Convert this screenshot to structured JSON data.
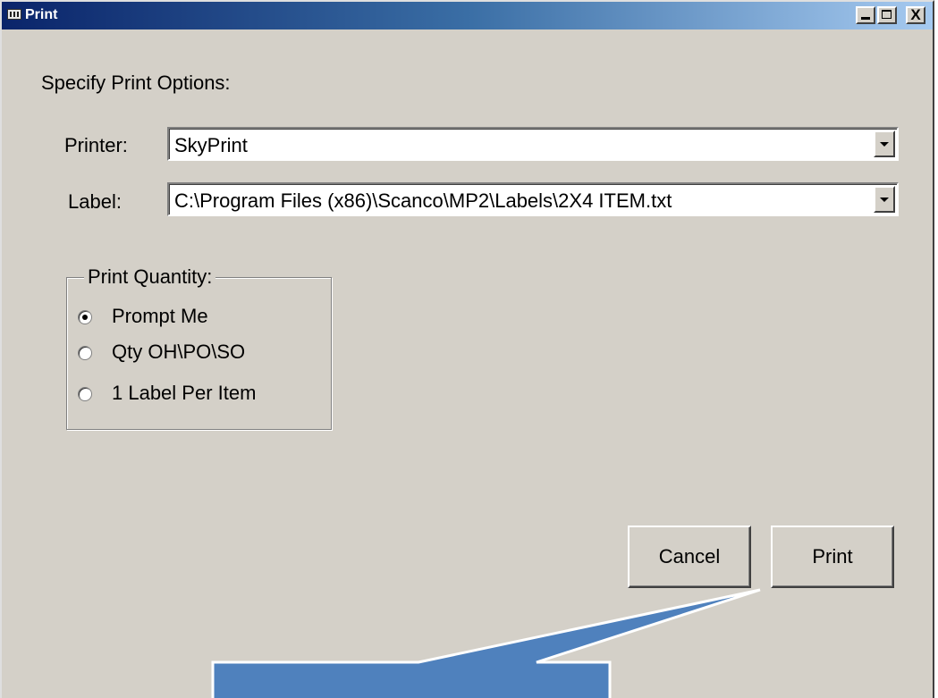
{
  "window": {
    "title": "Print",
    "controls": {
      "minimize": "_",
      "maximize": "□",
      "close": "X"
    }
  },
  "dialog": {
    "heading": "Specify Print Options:",
    "printer": {
      "label": "Printer:",
      "value": "SkyPrint"
    },
    "label_field": {
      "label": "Label:",
      "value": "C:\\Program Files (x86)\\Scanco\\MP2\\Labels\\2X4 ITEM.txt"
    },
    "print_quantity": {
      "legend": "Print Quantity:",
      "options": [
        {
          "label": "Prompt Me",
          "checked": true
        },
        {
          "label": "Qty OH\\PO\\SO",
          "checked": false
        },
        {
          "label": "1 Label Per Item",
          "checked": false
        }
      ]
    },
    "buttons": {
      "cancel": "Cancel",
      "print": "Print"
    }
  },
  "callout": {
    "color": "#4f81bd",
    "border_color": "#ffffff"
  }
}
